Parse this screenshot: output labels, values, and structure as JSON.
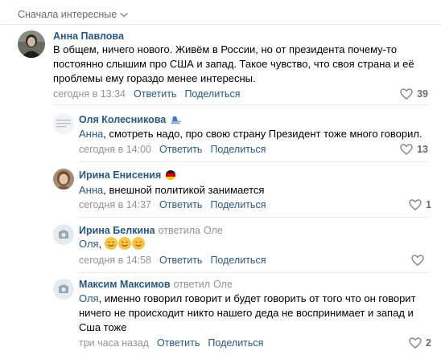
{
  "sort": {
    "label": "Сначала интересные"
  },
  "comments": [
    {
      "author": "Анна Павлова",
      "text": "В общем, ничего нового. Живём в России, но от президента почему-то постоянно слышим про США и запад. Такое чувство, что своя страна и её проблемы ему гораздо менее интересны.",
      "date": "сегодня в 13:34",
      "reply": "Ответить",
      "share": "Поделиться",
      "likes": "39"
    }
  ],
  "replies": [
    {
      "author": "Оля Колесникова",
      "mention": "Анна",
      "text": ", смотреть надо, про свою страну Президент тоже много говорил.",
      "date": "сегодня в 14:00",
      "reply": "Ответить",
      "share": "Поделиться",
      "likes": "13"
    },
    {
      "author": "Ирина Енисения",
      "mention": "Анна",
      "text": ", внешной политикой занимается",
      "date": "сегодня в 14:37",
      "reply": "Ответить",
      "share": "Поделиться",
      "likes": "1"
    },
    {
      "author": "Ирина Белкина",
      "replied_word": "ответила",
      "replied_to": "Оле",
      "mention": "Оля",
      "text": ", ",
      "date": "сегодня в 14:58",
      "reply": "Ответить",
      "share": "Поделиться"
    },
    {
      "author": "Максим Максимов",
      "replied_word": "ответил",
      "replied_to": "Оле",
      "mention": "Оля",
      "text": ", именно говорил говорит и будет говорить от того что он говорит ничего не происходит никто нашего деда не воспринимает и запад и Сша тоже",
      "date": "три часа назад",
      "reply": "Ответить",
      "share": "Поделиться",
      "likes": "2"
    }
  ],
  "colors": {
    "link": "#2a5885",
    "meta": "#939393",
    "separator": "#e7e8ec",
    "likes": "#626d7a"
  },
  "icons": [
    "chevron-down-icon",
    "heart-icon",
    "skating-emoji-icon",
    "germany-flag-icon",
    "smile-emoji-icon",
    "camera-placeholder-icon"
  ]
}
